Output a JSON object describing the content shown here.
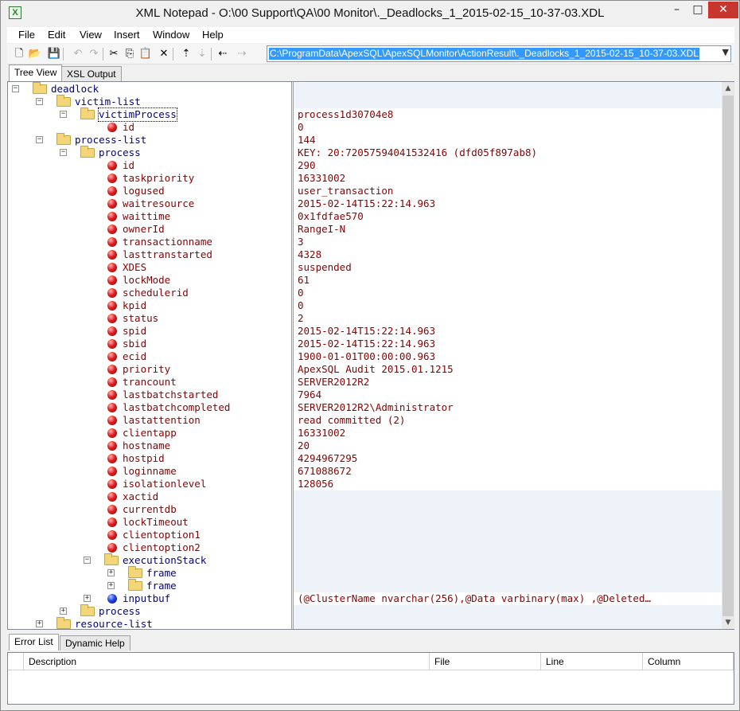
{
  "window": {
    "title": "XML Notepad - O:\\00 Support\\QA\\00 Monitor\\._Deadlocks_1_2015-02-15_10-37-03.XDL",
    "icon_letter": "X",
    "min_glyph": "–",
    "max_glyph": "□",
    "close_glyph": "✕"
  },
  "menu": [
    "File",
    "Edit",
    "View",
    "Insert",
    "Window",
    "Help"
  ],
  "toolbar": {
    "buttons": [
      {
        "name": "new-icon",
        "glyph": "🗋",
        "enabled": true
      },
      {
        "name": "open-icon",
        "glyph": "📂",
        "enabled": true
      },
      {
        "name": "save-icon",
        "glyph": "💾",
        "enabled": true
      },
      {
        "name": "undo-icon",
        "glyph": "↶",
        "enabled": false
      },
      {
        "name": "redo-icon",
        "glyph": "↷",
        "enabled": false
      },
      {
        "name": "cut-icon",
        "glyph": "✂",
        "enabled": true
      },
      {
        "name": "copy-icon",
        "glyph": "⎘",
        "enabled": true
      },
      {
        "name": "paste-icon",
        "glyph": "📋",
        "enabled": true
      },
      {
        "name": "delete-icon",
        "glyph": "✕",
        "enabled": true
      },
      {
        "name": "nudge-up-icon",
        "glyph": "⇡",
        "enabled": true
      },
      {
        "name": "nudge-down-icon",
        "glyph": "⇣",
        "enabled": false
      },
      {
        "name": "nudge-left-icon",
        "glyph": "⇠",
        "enabled": true
      },
      {
        "name": "nudge-right-icon",
        "glyph": "⇢",
        "enabled": false
      }
    ],
    "path": "C:\\ProgramData\\ApexSQL\\ApexSQLMonitor\\ActionResult\\._Deadlocks_1_2015-02-15_10-37-03.XDL",
    "dropdown_glyph": "▼"
  },
  "tabs": {
    "tree_view": "Tree View",
    "xsl_output": "XSL Output"
  },
  "tree": [
    {
      "label": "deadlock",
      "depth": 0,
      "icon": "folder",
      "exp": "−",
      "kind": "el"
    },
    {
      "label": "victim-list",
      "depth": 1,
      "icon": "folder",
      "exp": "−",
      "kind": "el"
    },
    {
      "label": "victimProcess",
      "depth": 2,
      "icon": "folder",
      "exp": "−",
      "kind": "el",
      "focus": true
    },
    {
      "label": "id",
      "depth": 3,
      "icon": "ball",
      "exp": "",
      "kind": "attr"
    },
    {
      "label": "process-list",
      "depth": 1,
      "icon": "folder",
      "exp": "−",
      "kind": "el"
    },
    {
      "label": "process",
      "depth": 2,
      "icon": "folder",
      "exp": "−",
      "kind": "el"
    },
    {
      "label": "id",
      "depth": 3,
      "icon": "ball",
      "exp": "",
      "kind": "attr"
    },
    {
      "label": "taskpriority",
      "depth": 3,
      "icon": "ball",
      "exp": "",
      "kind": "attr"
    },
    {
      "label": "logused",
      "depth": 3,
      "icon": "ball",
      "exp": "",
      "kind": "attr"
    },
    {
      "label": "waitresource",
      "depth": 3,
      "icon": "ball",
      "exp": "",
      "kind": "attr"
    },
    {
      "label": "waittime",
      "depth": 3,
      "icon": "ball",
      "exp": "",
      "kind": "attr"
    },
    {
      "label": "ownerId",
      "depth": 3,
      "icon": "ball",
      "exp": "",
      "kind": "attr"
    },
    {
      "label": "transactionname",
      "depth": 3,
      "icon": "ball",
      "exp": "",
      "kind": "attr"
    },
    {
      "label": "lasttranstarted",
      "depth": 3,
      "icon": "ball",
      "exp": "",
      "kind": "attr"
    },
    {
      "label": "XDES",
      "depth": 3,
      "icon": "ball",
      "exp": "",
      "kind": "attr"
    },
    {
      "label": "lockMode",
      "depth": 3,
      "icon": "ball",
      "exp": "",
      "kind": "attr"
    },
    {
      "label": "schedulerid",
      "depth": 3,
      "icon": "ball",
      "exp": "",
      "kind": "attr"
    },
    {
      "label": "kpid",
      "depth": 3,
      "icon": "ball",
      "exp": "",
      "kind": "attr"
    },
    {
      "label": "status",
      "depth": 3,
      "icon": "ball",
      "exp": "",
      "kind": "attr"
    },
    {
      "label": "spid",
      "depth": 3,
      "icon": "ball",
      "exp": "",
      "kind": "attr"
    },
    {
      "label": "sbid",
      "depth": 3,
      "icon": "ball",
      "exp": "",
      "kind": "attr"
    },
    {
      "label": "ecid",
      "depth": 3,
      "icon": "ball",
      "exp": "",
      "kind": "attr"
    },
    {
      "label": "priority",
      "depth": 3,
      "icon": "ball",
      "exp": "",
      "kind": "attr"
    },
    {
      "label": "trancount",
      "depth": 3,
      "icon": "ball",
      "exp": "",
      "kind": "attr"
    },
    {
      "label": "lastbatchstarted",
      "depth": 3,
      "icon": "ball",
      "exp": "",
      "kind": "attr"
    },
    {
      "label": "lastbatchcompleted",
      "depth": 3,
      "icon": "ball",
      "exp": "",
      "kind": "attr"
    },
    {
      "label": "lastattention",
      "depth": 3,
      "icon": "ball",
      "exp": "",
      "kind": "attr"
    },
    {
      "label": "clientapp",
      "depth": 3,
      "icon": "ball",
      "exp": "",
      "kind": "attr"
    },
    {
      "label": "hostname",
      "depth": 3,
      "icon": "ball",
      "exp": "",
      "kind": "attr"
    },
    {
      "label": "hostpid",
      "depth": 3,
      "icon": "ball",
      "exp": "",
      "kind": "attr"
    },
    {
      "label": "loginname",
      "depth": 3,
      "icon": "ball",
      "exp": "",
      "kind": "attr"
    },
    {
      "label": "isolationlevel",
      "depth": 3,
      "icon": "ball",
      "exp": "",
      "kind": "attr"
    },
    {
      "label": "xactid",
      "depth": 3,
      "icon": "ball",
      "exp": "",
      "kind": "attr"
    },
    {
      "label": "currentdb",
      "depth": 3,
      "icon": "ball",
      "exp": "",
      "kind": "attr"
    },
    {
      "label": "lockTimeout",
      "depth": 3,
      "icon": "ball",
      "exp": "",
      "kind": "attr"
    },
    {
      "label": "clientoption1",
      "depth": 3,
      "icon": "ball",
      "exp": "",
      "kind": "attr"
    },
    {
      "label": "clientoption2",
      "depth": 3,
      "icon": "ball",
      "exp": "",
      "kind": "attr"
    },
    {
      "label": "executionStack",
      "depth": 3,
      "icon": "folder",
      "exp": "−",
      "kind": "el"
    },
    {
      "label": "frame",
      "depth": 4,
      "icon": "folder",
      "exp": "+",
      "kind": "el"
    },
    {
      "label": "frame",
      "depth": 4,
      "icon": "folder",
      "exp": "+",
      "kind": "el"
    },
    {
      "label": "inputbuf",
      "depth": 3,
      "icon": "ball-blue",
      "exp": "+",
      "kind": "el"
    },
    {
      "label": "process",
      "depth": 2,
      "icon": "folder",
      "exp": "+",
      "kind": "el"
    },
    {
      "label": "resource-list",
      "depth": 1,
      "icon": "folder",
      "exp": "+",
      "kind": "el"
    }
  ],
  "values": [
    "",
    "",
    "process1d30704e8",
    "0",
    "144",
    "KEY: 20:72057594041532416 (dfd05f897ab8)",
    "290",
    "16331002",
    "user_transaction",
    "2015-02-14T15:22:14.963",
    "0x1fdfae570",
    "RangeI-N",
    "3",
    "4328",
    "suspended",
    "61",
    "0",
    "0",
    "2",
    "2015-02-14T15:22:14.963",
    "2015-02-14T15:22:14.963",
    "1900-01-01T00:00:00.963",
    "ApexSQL Audit 2015.01.1215",
    "SERVER2012R2",
    "7964",
    "SERVER2012R2\\Administrator",
    "read committed (2)",
    "16331002",
    "20",
    "4294967295",
    "671088672",
    "128056",
    "",
    "",
    "",
    "",
    "",
    "",
    "",
    "",
    "(@ClusterName nvarchar(256),@Data varbinary(max) ,@Deleted…",
    "",
    ""
  ],
  "scroll": {
    "up_glyph": "▲",
    "down_glyph": "▼"
  },
  "bottom_tabs": {
    "error_list": "Error List",
    "dynamic_help": "Dynamic Help"
  },
  "error_columns": [
    "Description",
    "File",
    "Line",
    "Column"
  ]
}
